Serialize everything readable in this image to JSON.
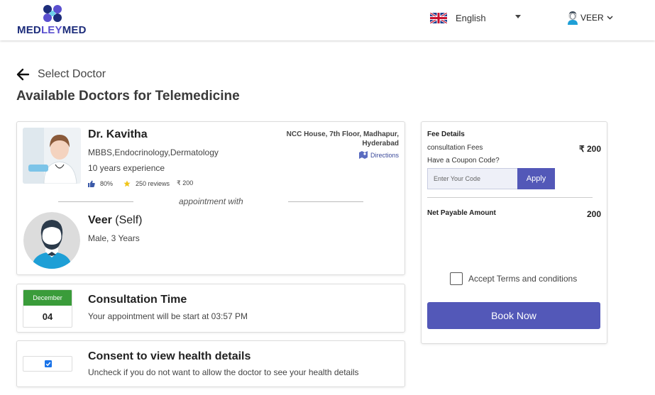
{
  "header": {
    "logo": {
      "part1": "MED",
      "part2": "LEY",
      "part3": "MED"
    },
    "language": "English",
    "user_name": "VEER"
  },
  "page": {
    "breadcrumb": "Select Doctor",
    "title": "Available Doctors for Telemedicine"
  },
  "doctor": {
    "name": "Dr. Kavitha",
    "specialization": "MBBS,Endocrinology,Dermatology",
    "experience": "10 years experience",
    "rating": "80%",
    "reviews": "250 reviews",
    "fee": "₹ 200",
    "address": "NCC House, 7th Floor, Madhapur, Hyderabad",
    "directions_label": "Directions"
  },
  "appointment_with": "appointment with",
  "patient": {
    "name": "Veer",
    "relation": "(Self)",
    "info": "Male, 3 Years"
  },
  "consultation": {
    "month": "December",
    "day": "04",
    "title": "Consultation Time",
    "subtitle": "Your appointment will be start at 03:57 PM"
  },
  "consent": {
    "checked": true,
    "title": "Consent to view health details",
    "subtitle": "Uncheck if you do not want to allow the doctor to see your health details"
  },
  "fees": {
    "title": "Fee Details",
    "consultation_label": "consultation Fees",
    "consultation_amount": "₹ 200",
    "coupon_question": "Have a Coupon Code?",
    "coupon_placeholder": "Enter Your Code",
    "apply_label": "Apply",
    "net_label": "Net Payable Amount",
    "net_amount": "200",
    "terms_label": "Accept Terms and conditions",
    "book_label": "Book Now"
  },
  "colors": {
    "brand_navy": "#1d2d7b",
    "brand_purple": "#5358b8",
    "calendar_green": "#3a9c3a",
    "avatar_bg": "#dcdcdc",
    "avatar_shirt": "#1e9fd6"
  },
  "icons": {
    "back": "arrow-left-icon",
    "thumb": "thumbs-up-icon",
    "star": "star-icon",
    "directions": "map-icon",
    "user": "user-icon",
    "chevron": "chevron-down-icon",
    "flag": "uk-flag-icon"
  }
}
